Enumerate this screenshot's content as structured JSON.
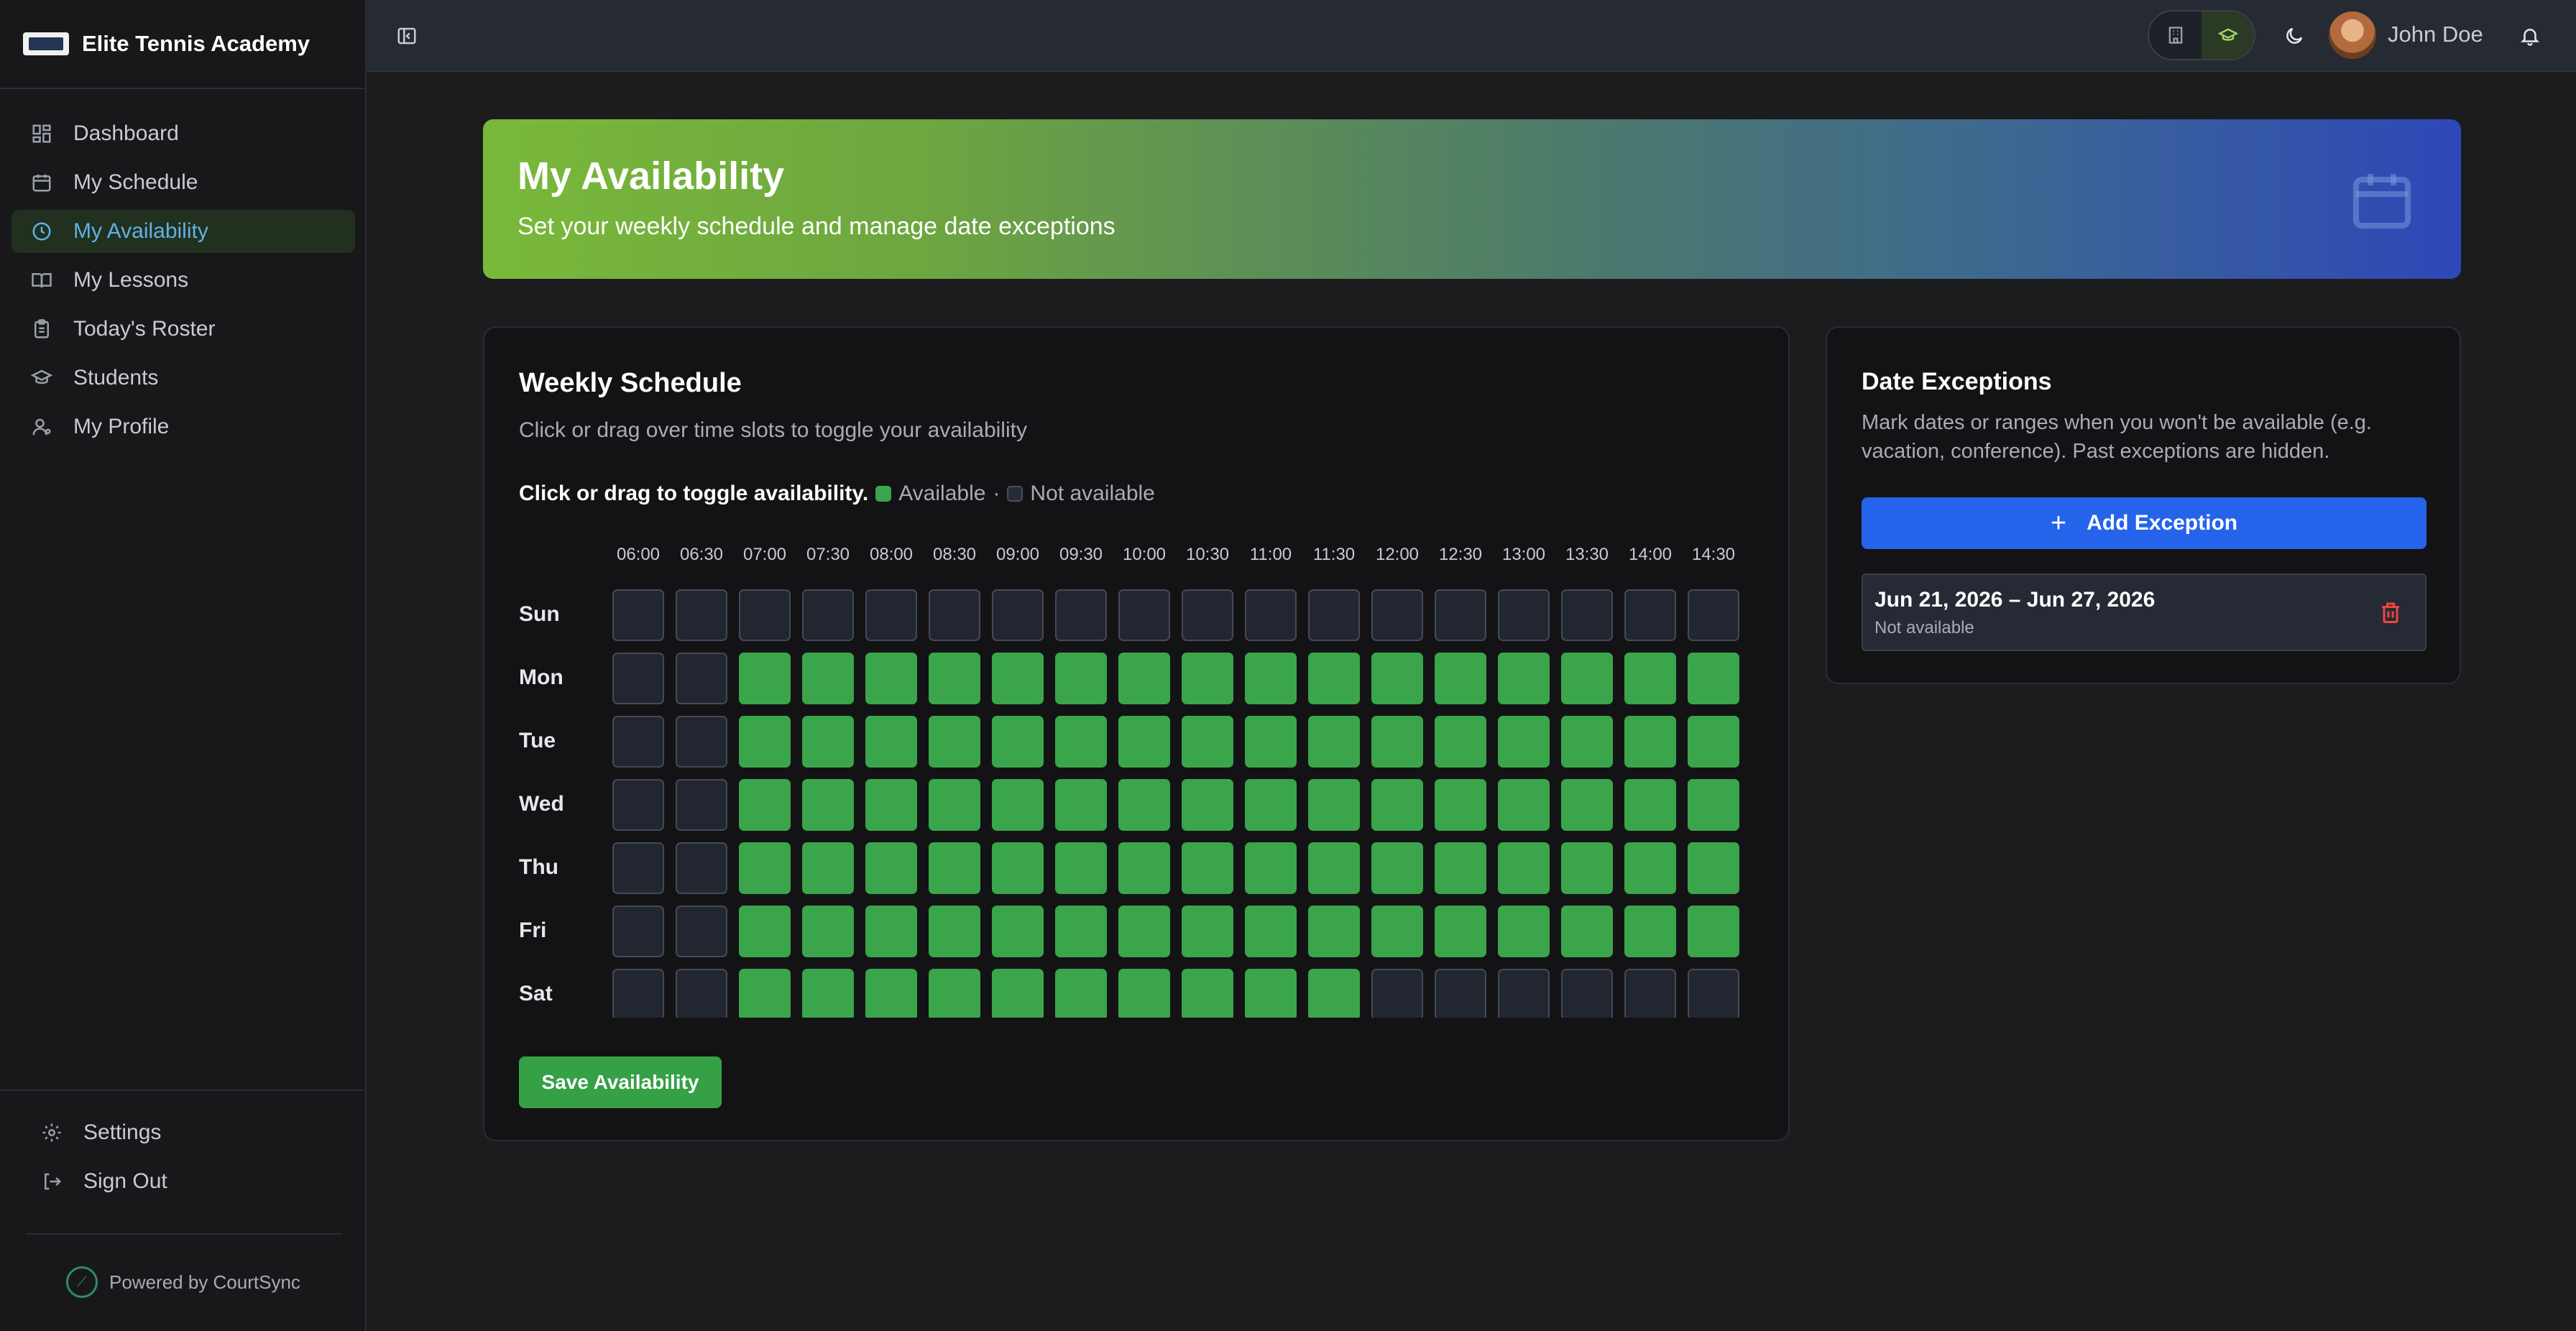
{
  "sidebar": {
    "brand": "Elite Tennis Academy",
    "items": [
      {
        "label": "Dashboard",
        "icon": "dashboard-icon"
      },
      {
        "label": "My Schedule",
        "icon": "calendar-icon"
      },
      {
        "label": "My Availability",
        "icon": "clock-icon",
        "active": true
      },
      {
        "label": "My Lessons",
        "icon": "book-icon"
      },
      {
        "label": "Today's Roster",
        "icon": "clipboard-icon"
      },
      {
        "label": "Students",
        "icon": "graduation-cap-icon"
      },
      {
        "label": "My Profile",
        "icon": "user-icon"
      }
    ],
    "bottom": [
      {
        "label": "Settings",
        "icon": "gear-icon"
      },
      {
        "label": "Sign Out",
        "icon": "sign-out-icon"
      }
    ],
    "powered_by": "Powered by CourtSync"
  },
  "header": {
    "user_name": "John Doe"
  },
  "banner": {
    "title": "My Availability",
    "subtitle": "Set your weekly schedule and manage date exceptions"
  },
  "weekly": {
    "title": "Weekly Schedule",
    "subtitle": "Click or drag over time slots to toggle your availability",
    "instruction": "Click or drag to toggle availability.",
    "legend_available": "Available",
    "legend_separator": "·",
    "legend_unavailable": "Not available",
    "times": [
      "06:00",
      "06:30",
      "07:00",
      "07:30",
      "08:00",
      "08:30",
      "09:00",
      "09:30",
      "10:00",
      "10:30",
      "11:00",
      "11:30",
      "12:00",
      "12:30",
      "13:00",
      "13:30",
      "14:00",
      "14:30"
    ],
    "days": [
      {
        "label": "Sun",
        "slots": [
          0,
          0,
          0,
          0,
          0,
          0,
          0,
          0,
          0,
          0,
          0,
          0,
          0,
          0,
          0,
          0,
          0,
          0
        ]
      },
      {
        "label": "Mon",
        "slots": [
          0,
          0,
          1,
          1,
          1,
          1,
          1,
          1,
          1,
          1,
          1,
          1,
          1,
          1,
          1,
          1,
          1,
          1
        ]
      },
      {
        "label": "Tue",
        "slots": [
          0,
          0,
          1,
          1,
          1,
          1,
          1,
          1,
          1,
          1,
          1,
          1,
          1,
          1,
          1,
          1,
          1,
          1
        ]
      },
      {
        "label": "Wed",
        "slots": [
          0,
          0,
          1,
          1,
          1,
          1,
          1,
          1,
          1,
          1,
          1,
          1,
          1,
          1,
          1,
          1,
          1,
          1
        ]
      },
      {
        "label": "Thu",
        "slots": [
          0,
          0,
          1,
          1,
          1,
          1,
          1,
          1,
          1,
          1,
          1,
          1,
          1,
          1,
          1,
          1,
          1,
          1
        ]
      },
      {
        "label": "Fri",
        "slots": [
          0,
          0,
          1,
          1,
          1,
          1,
          1,
          1,
          1,
          1,
          1,
          1,
          1,
          1,
          1,
          1,
          1,
          1
        ]
      },
      {
        "label": "Sat",
        "slots": [
          0,
          0,
          1,
          1,
          1,
          1,
          1,
          1,
          1,
          1,
          1,
          1,
          0,
          0,
          0,
          0,
          0,
          0
        ]
      }
    ],
    "save_label": "Save Availability",
    "colors": {
      "available": "#3aa54b",
      "unavailable": "#222630"
    }
  },
  "exceptions": {
    "title": "Date Exceptions",
    "subtitle": "Mark dates or ranges when you won't be available (e.g. vacation, conference). Past exceptions are hidden.",
    "add_label": "Add Exception",
    "items": [
      {
        "range": "Jun 21, 2026 – Jun 27, 2026",
        "status": "Not available"
      }
    ]
  }
}
